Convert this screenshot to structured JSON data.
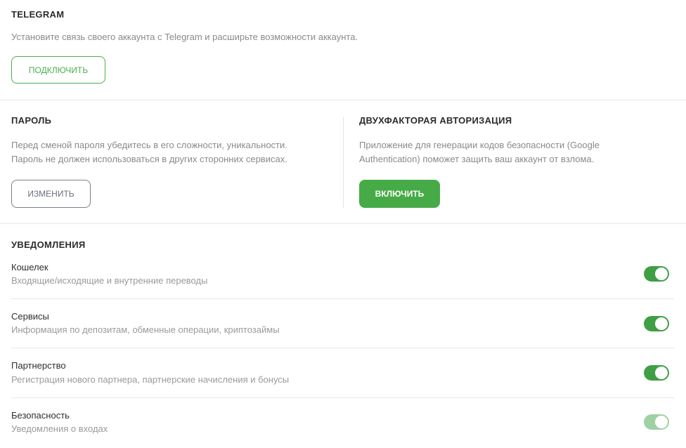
{
  "telegram": {
    "title": "TELEGRAM",
    "description": "Установите связь своего аккаунта с Telegram и расширьте возможности аккаунта.",
    "connect_label": "ПОДКЛЮЧИТЬ"
  },
  "password": {
    "title": "ПАРОЛЬ",
    "line1": "Перед сменой пароля убедитесь в его сложности, уникальности.",
    "line2": "Пароль не должен использоваться в других сторонних сервисах.",
    "change_label": "ИЗМЕНИТЬ"
  },
  "twofa": {
    "title": "ДВУХФАКТОРАЯ АВТОРИЗАЦИЯ",
    "line1": "Приложение для генерации кодов безопасности (Google",
    "line2": "Authentication) поможет защить ваш аккаунт от взлома.",
    "enable_label": "ВКЛЮЧИТЬ"
  },
  "notifications": {
    "title": "УВЕДОМЛЕНИЯ",
    "items": [
      {
        "title": "Кошелек",
        "description": "Входящие/исходящие и внутренние переводы",
        "enabled": true
      },
      {
        "title": "Сервисы",
        "description": "Информация по депозитам, обменные операции, криптозаймы",
        "enabled": true
      },
      {
        "title": "Партнерство",
        "description": "Регистрация нового партнера, партнерские начисления и бонусы",
        "enabled": true
      },
      {
        "title": "Безопасность",
        "description": "Уведомления о входах",
        "enabled": true
      }
    ]
  },
  "colors": {
    "accent_green": "#46ab46",
    "toggle_on": "#3f9f45",
    "toggle_dim": "#9fd1a4",
    "outline_gray": "#7a7f88"
  }
}
